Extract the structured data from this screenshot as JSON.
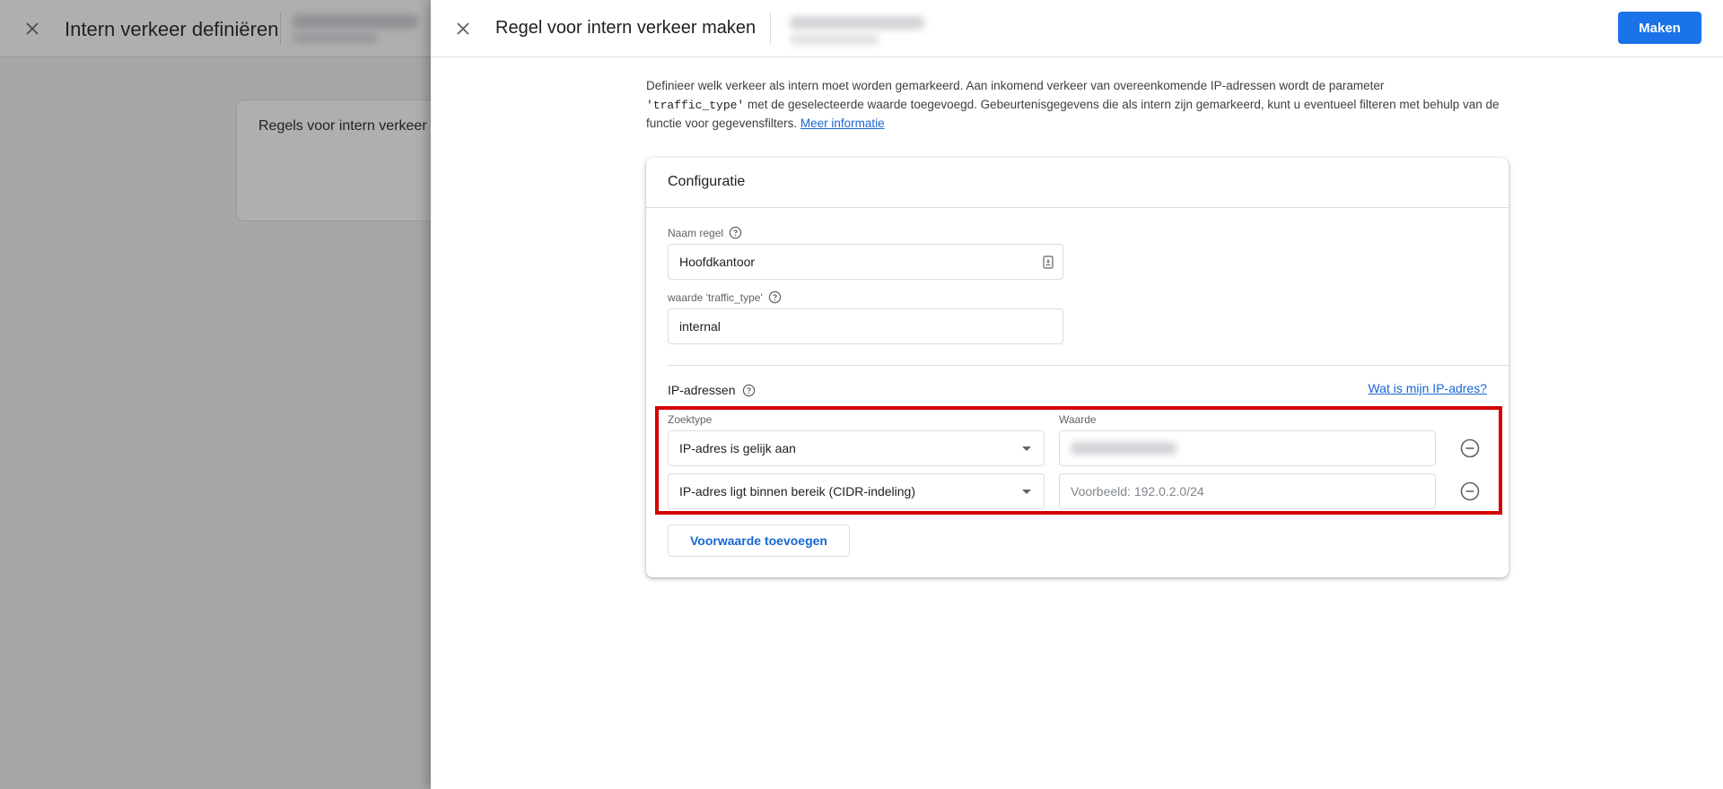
{
  "background": {
    "title": "Intern verkeer definiëren",
    "card_title": "Regels voor intern verkeer"
  },
  "drawer": {
    "title": "Regel voor intern verkeer maken",
    "primary_button": "Maken"
  },
  "description": {
    "part1": "Definieer welk verkeer als intern moet worden gemarkeerd. Aan inkomend verkeer van overeenkomende IP-adressen wordt de parameter",
    "code": "'traffic_type'",
    "part2": " met de geselecteerde waarde toegevoegd. Gebeurtenisgegevens die als intern zijn gemarkeerd, kunt u eventueel filteren met behulp van de functie voor gegevensfilters. ",
    "link": "Meer informatie"
  },
  "config": {
    "title": "Configuratie",
    "rule_name": {
      "label": "Naam regel",
      "value": "Hoofdkantoor"
    },
    "traffic_type": {
      "label": "waarde 'traffic_type'",
      "value": "internal"
    },
    "ip": {
      "title": "IP-adressen",
      "help_link": "Wat is mijn IP-adres?",
      "col_match": "Zoektype",
      "col_value": "Waarde",
      "rows": [
        {
          "match_type": "IP-adres is gelijk aan",
          "value": "",
          "placeholder": ""
        },
        {
          "match_type": "IP-adres ligt binnen bereik (CIDR-indeling)",
          "value": "",
          "placeholder": "Voorbeeld: 192.0.2.0/24"
        }
      ],
      "add_button": "Voorwaarde toevoegen"
    }
  },
  "colors": {
    "primary": "#1a73e8",
    "link": "#1967d2",
    "highlight": "#d40000"
  }
}
